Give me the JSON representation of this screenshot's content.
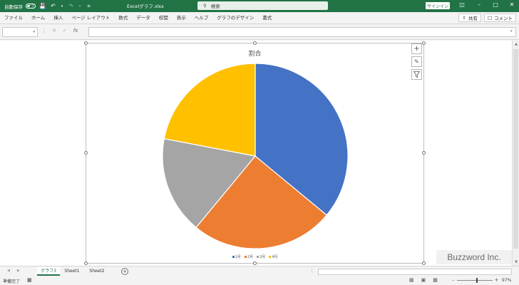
{
  "titlebar": {
    "autosave_label": "自動保存",
    "autosave_state": "オフ",
    "filename": "Excelグラフ.xlsx",
    "search_placeholder": "検索",
    "signin_label": "サインイン",
    "bg_color": "#217346"
  },
  "ribbon": {
    "tabs": [
      "ファイル",
      "ホーム",
      "挿入",
      "ページ レイアウト",
      "数式",
      "データ",
      "校閲",
      "表示",
      "ヘルプ",
      "グラフのデザイン",
      "書式"
    ],
    "share_label": "共有",
    "comment_label": "コメント"
  },
  "formula_bar": {
    "name_box_value": "",
    "formula_value": ""
  },
  "chart_data": {
    "type": "pie",
    "title": "割合",
    "categories": [
      "1月",
      "2月",
      "3月",
      "4月"
    ],
    "values": [
      36,
      25,
      17,
      22
    ],
    "colors": [
      "#4472c4",
      "#ed7d31",
      "#a5a5a5",
      "#ffc000"
    ],
    "legend": "bottom",
    "start_angle_deg": 0,
    "direction": "clockwise"
  },
  "sheet_tabs": {
    "tabs": [
      "グラフ3",
      "Sheet1",
      "Sheet2"
    ],
    "active": "グラフ3"
  },
  "statusbar": {
    "ready_label": "準備完了",
    "zoom_percent": "97%",
    "zoom_value": 97
  },
  "watermark": "Buzzword Inc."
}
